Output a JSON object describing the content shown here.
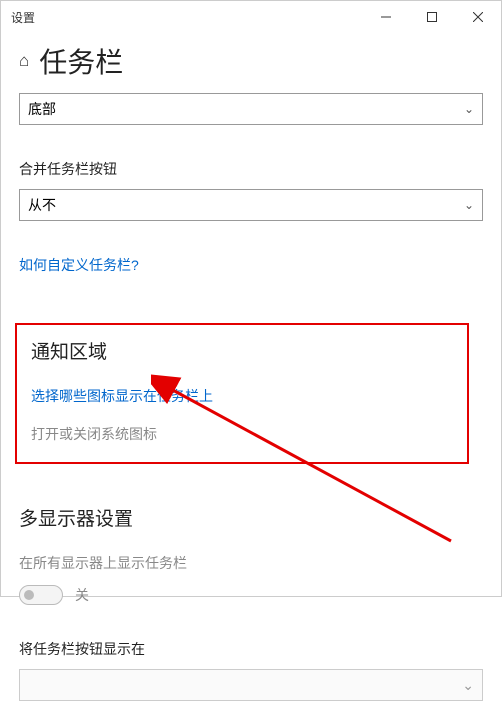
{
  "window": {
    "title": "设置"
  },
  "header": {
    "title": "任务栏"
  },
  "taskbar_position": {
    "selected": "底部"
  },
  "combine_buttons": {
    "label": "合并任务栏按钮",
    "selected": "从不"
  },
  "customize_link": "如何自定义任务栏?",
  "notification_area": {
    "title": "通知区域",
    "select_icons_link": "选择哪些图标显示在任务栏上",
    "system_icons_text": "打开或关闭系统图标"
  },
  "multi_display": {
    "title": "多显示器设置",
    "show_on_all_label": "在所有显示器上显示任务栏",
    "toggle_state": "关",
    "buttons_show_label": "将任务栏按钮显示在"
  }
}
